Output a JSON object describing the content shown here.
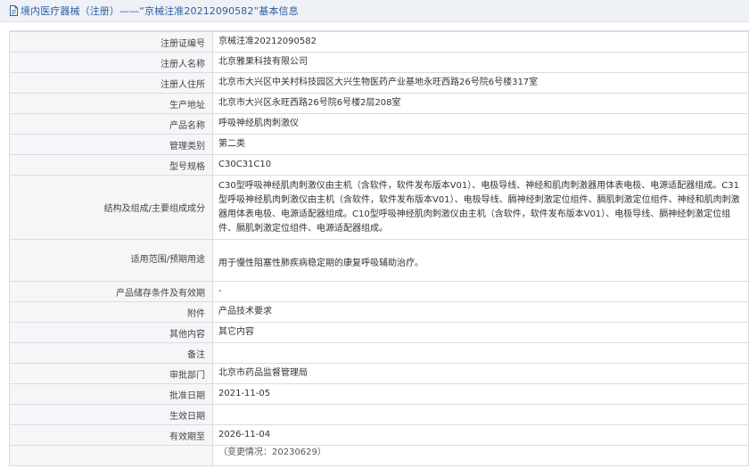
{
  "header": {
    "title": "境内医疗器械（注册）——“京械注准20212090582”基本信息"
  },
  "rows": [
    {
      "label": "注册证编号",
      "value": "京械注准20212090582"
    },
    {
      "label": "注册人名称",
      "value": "北京雅果科技有限公司"
    },
    {
      "label": "注册人住所",
      "value": "北京市大兴区中关村科技园区大兴生物医药产业基地永旺西路26号院6号楼317室"
    },
    {
      "label": "生产地址",
      "value": "北京市大兴区永旺西路26号院6号楼2层208室"
    },
    {
      "label": "产品名称",
      "value": "呼吸神经肌肉刺激仪"
    },
    {
      "label": "管理类别",
      "value": "第二类"
    },
    {
      "label": "型号规格",
      "value": "C30C31C10"
    },
    {
      "label": "结构及组成/主要组成成分",
      "value": "C30型呼吸神经肌肉刺激仪由主机（含软件，软件发布版本V01）、电极导线、神经和肌肉刺激器用体表电极、电源适配器组成。C31型呼吸神经肌肉刺激仪由主机（含软件，软件发布版本V01）、电极导线、膈神经刺激定位组件、膈肌刺激定位组件、神经和肌肉刺激器用体表电极、电源适配器组成。C10型呼吸神经肌肉刺激仪由主机（含软件，软件发布版本V01）、电极导线、膈神经刺激定位组件、膈肌刺激定位组件、电源适配器组成。"
    },
    {
      "label": "适用范围/预期用途",
      "value": "用于慢性阻塞性肺疾病稳定期的康复呼吸辅助治疗。"
    },
    {
      "label": "产品储存条件及有效期",
      "value": "-"
    },
    {
      "label": "附件",
      "value": "产品技术要求"
    },
    {
      "label": "其他内容",
      "value": "其它内容"
    },
    {
      "label": "备注",
      "value": ""
    },
    {
      "label": "审批部门",
      "value": "北京市药品监督管理局"
    },
    {
      "label": "批准日期",
      "value": "2021-11-05"
    },
    {
      "label": "生效日期",
      "value": ""
    },
    {
      "label": "有效期至",
      "value": "2026-11-04"
    },
    {
      "label": "",
      "value": "（变更情况：20230629）"
    }
  ]
}
